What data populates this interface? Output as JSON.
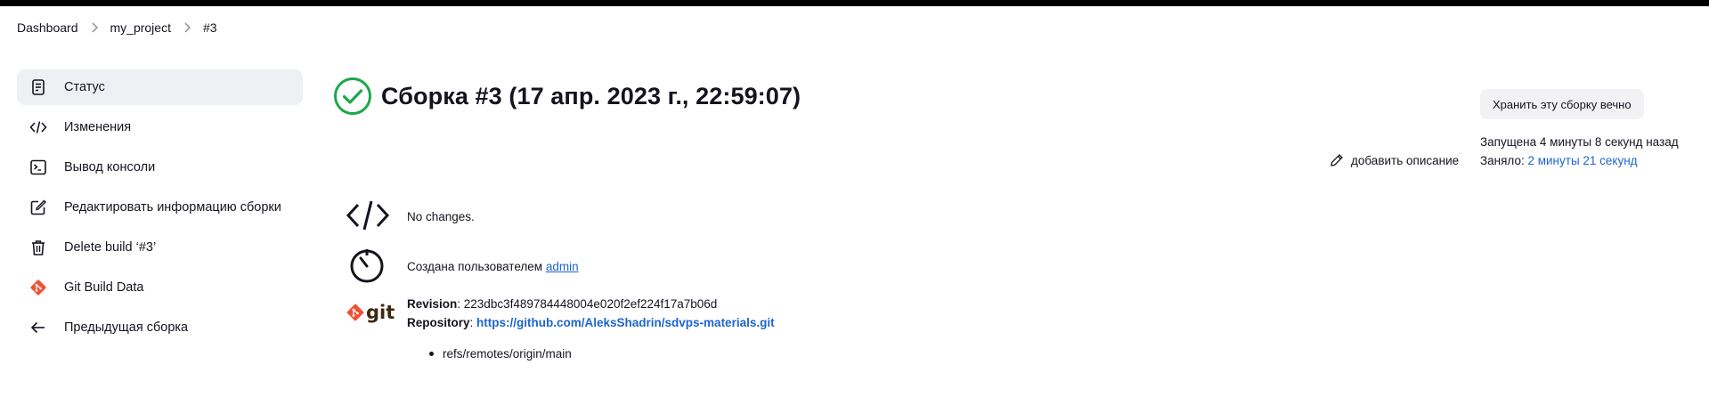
{
  "breadcrumbs": [
    "Dashboard",
    "my_project",
    "#3"
  ],
  "sidebar": {
    "items": [
      {
        "label": "Статус",
        "icon": "status-document-icon",
        "active": true
      },
      {
        "label": "Изменения",
        "icon": "code-brackets-icon",
        "active": false
      },
      {
        "label": "Вывод консоли",
        "icon": "terminal-icon",
        "active": false
      },
      {
        "label": "Редактировать информацию сборки",
        "icon": "edit-icon",
        "active": false
      },
      {
        "label": "Delete build ‘#3’",
        "icon": "trash-icon",
        "active": false
      },
      {
        "label": "Git Build Data",
        "icon": "git-logo-icon",
        "active": false
      },
      {
        "label": "Предыдущая сборка",
        "icon": "arrow-left-icon",
        "active": false
      }
    ]
  },
  "build": {
    "title": "Сборка #3 (17 апр. 2023 г., 22:59:07)",
    "status": "success",
    "keep_button": "Хранить эту сборку вечно",
    "started": "Запущена 4 минуты 8 секунд назад",
    "duration_label": "Заняло: ",
    "duration_value": "2 минуты 21 секунд",
    "add_description": "добавить описание"
  },
  "changes": {
    "text": "No changes."
  },
  "cause": {
    "prefix": "Создана пользователем ",
    "user": "admin"
  },
  "git": {
    "logo_text": "git",
    "revision_label": "Revision",
    "revision_value": ": 223dbc3f489784448004e020f2ef224f17a7b06d",
    "repository_label": "Repository",
    "repository_sep": ": ",
    "repository_url": "https://github.com/AleksShadrin/sdvps-materials.git",
    "branches": [
      "refs/remotes/origin/main"
    ]
  },
  "colors": {
    "success": "#1ea64b",
    "link": "#1d65d0",
    "git_orange": "#f05133",
    "active_bg": "#eff0f4"
  }
}
